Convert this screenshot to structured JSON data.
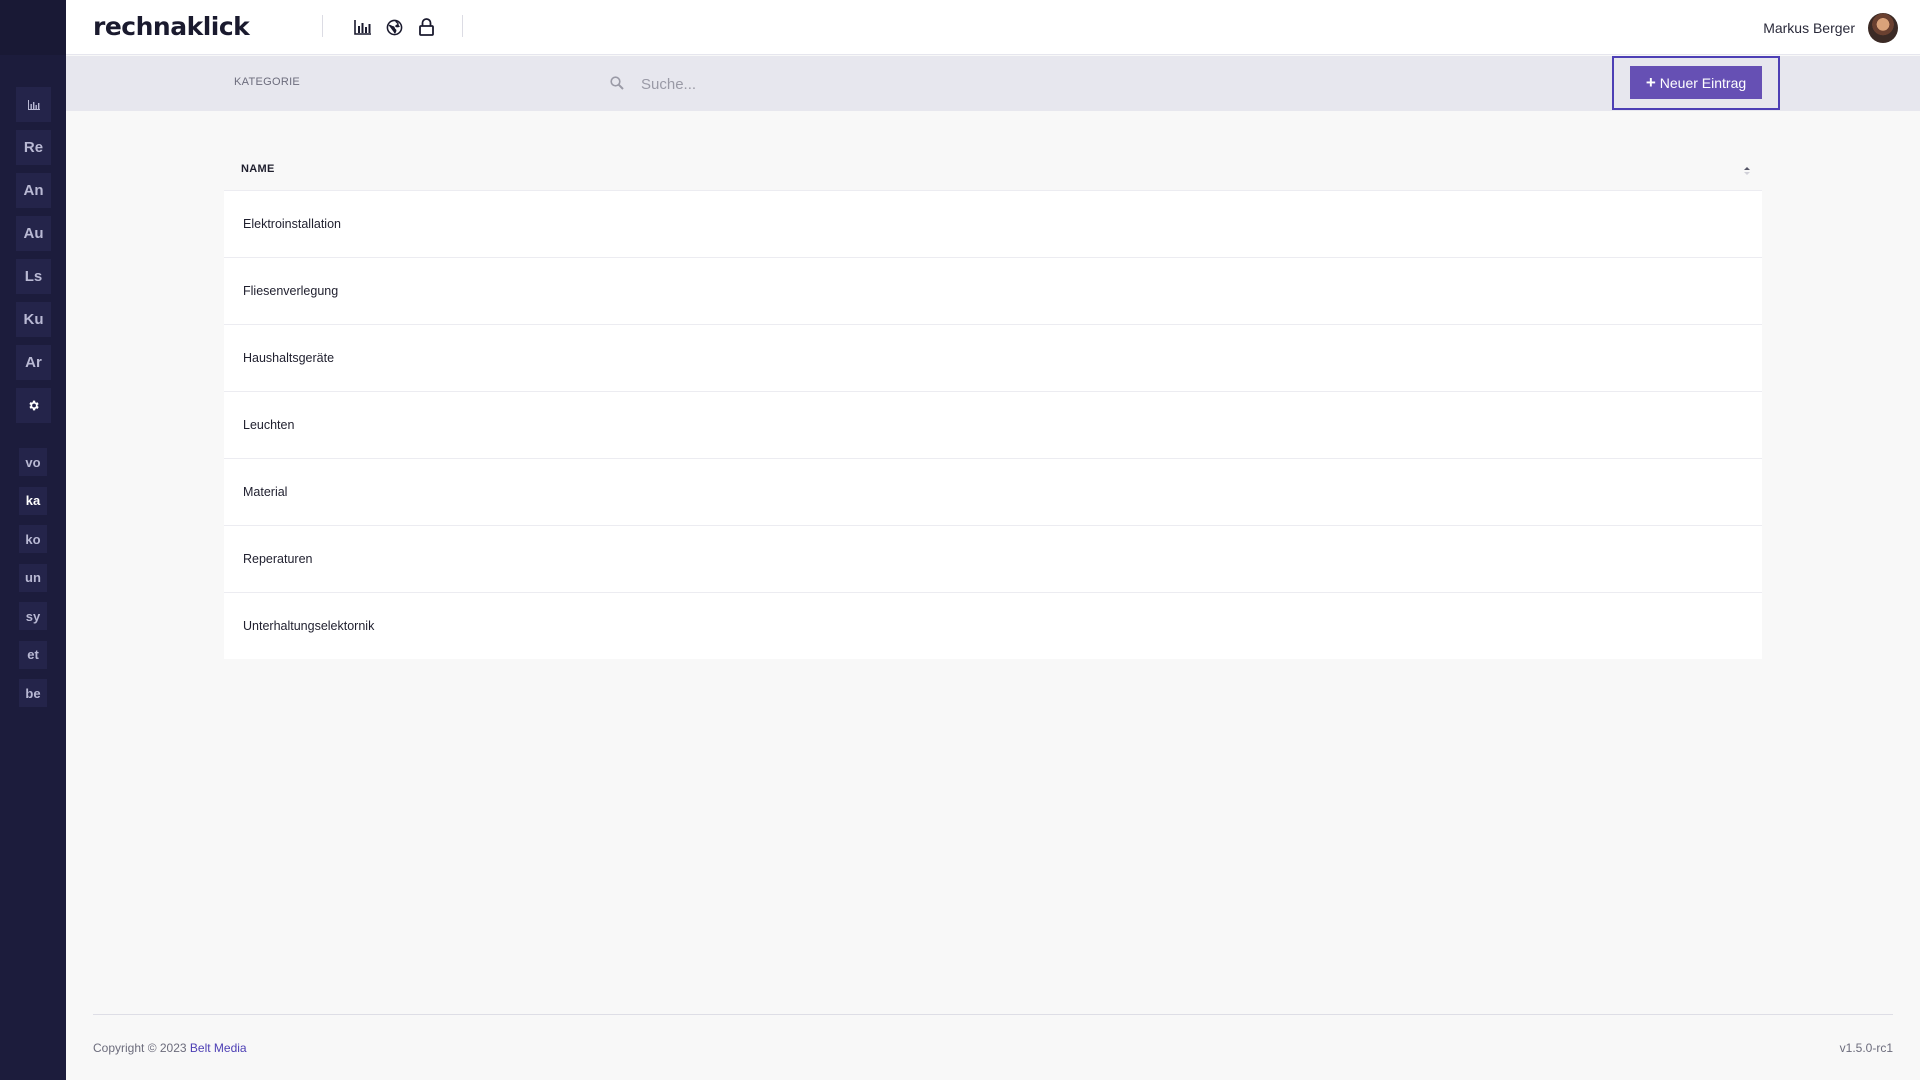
{
  "app": {
    "logo_text": "rechnaklick"
  },
  "header": {
    "icons": [
      "chart-icon",
      "globe-icon",
      "lock-icon"
    ],
    "user_name": "Markus Berger"
  },
  "sidebar": {
    "main_items": [
      {
        "label": "",
        "icon": "chart-icon"
      },
      {
        "label": "Re"
      },
      {
        "label": "An"
      },
      {
        "label": "Au"
      },
      {
        "label": "Ls"
      },
      {
        "label": "Ku"
      },
      {
        "label": "Ar"
      },
      {
        "label": "",
        "icon": "gear-icon",
        "active": true
      }
    ],
    "sub_items": [
      {
        "label": "vo"
      },
      {
        "label": "ka",
        "active": true
      },
      {
        "label": "ko"
      },
      {
        "label": "un"
      },
      {
        "label": "sy"
      },
      {
        "label": "et"
      },
      {
        "label": "be"
      }
    ]
  },
  "toolbar": {
    "category_label": "KATEGORIE",
    "search_placeholder": "Suche...",
    "search_value": "",
    "new_button_label": "Neuer Eintrag",
    "new_button_icon": "plus-icon"
  },
  "table": {
    "columns": [
      "NAME"
    ],
    "rows": [
      "Elektroinstallation",
      "Fliesenverlegung",
      "Haushaltsgeräte",
      "Leuchten",
      "Material",
      "Reperaturen",
      "Unterhaltungselektornik"
    ]
  },
  "footer": {
    "copyright_prefix": "Copyright © 2023 ",
    "company": "Belt Media",
    "version": "v1.5.0-rc1"
  },
  "colors": {
    "sidebar_bg": "#1c1c3c",
    "accent": "#6650b4",
    "toolbar_bg": "#e7e7ee"
  }
}
